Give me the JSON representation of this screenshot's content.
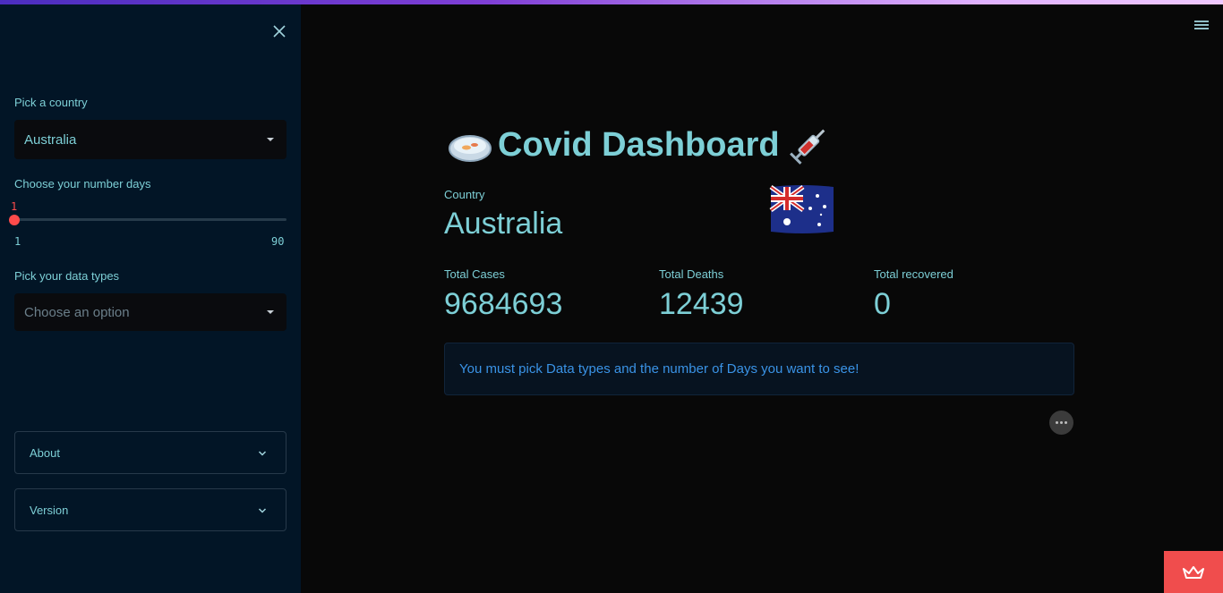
{
  "sidebar": {
    "country_label": "Pick a country",
    "country_value": "Australia",
    "days_label": "Choose your number days",
    "days_value": "1",
    "days_min": "1",
    "days_max": "90",
    "datatypes_label": "Pick your data types",
    "datatypes_placeholder": "Choose an option",
    "expanders": [
      {
        "label": "About"
      },
      {
        "label": "Version"
      }
    ]
  },
  "main": {
    "title": "Covid Dashboard",
    "title_left_icon": "petri-dish-icon",
    "title_right_icon": "syringe-icon",
    "country_label": "Country",
    "country_value": "Australia",
    "flag_icon": "australia-flag-icon",
    "metrics": [
      {
        "label": "Total Cases",
        "value": "9684693"
      },
      {
        "label": "Total Deaths",
        "value": "12439"
      },
      {
        "label": "Total recovered",
        "value": "0"
      }
    ],
    "info_message": "You must pick Data types and the number of Days you want to see!"
  },
  "colors": {
    "accent": "#7dcfd6",
    "slider": "#ff4b4b",
    "info_text": "#3a93e6",
    "sidebar_bg": "#021526",
    "main_bg": "#080808"
  }
}
